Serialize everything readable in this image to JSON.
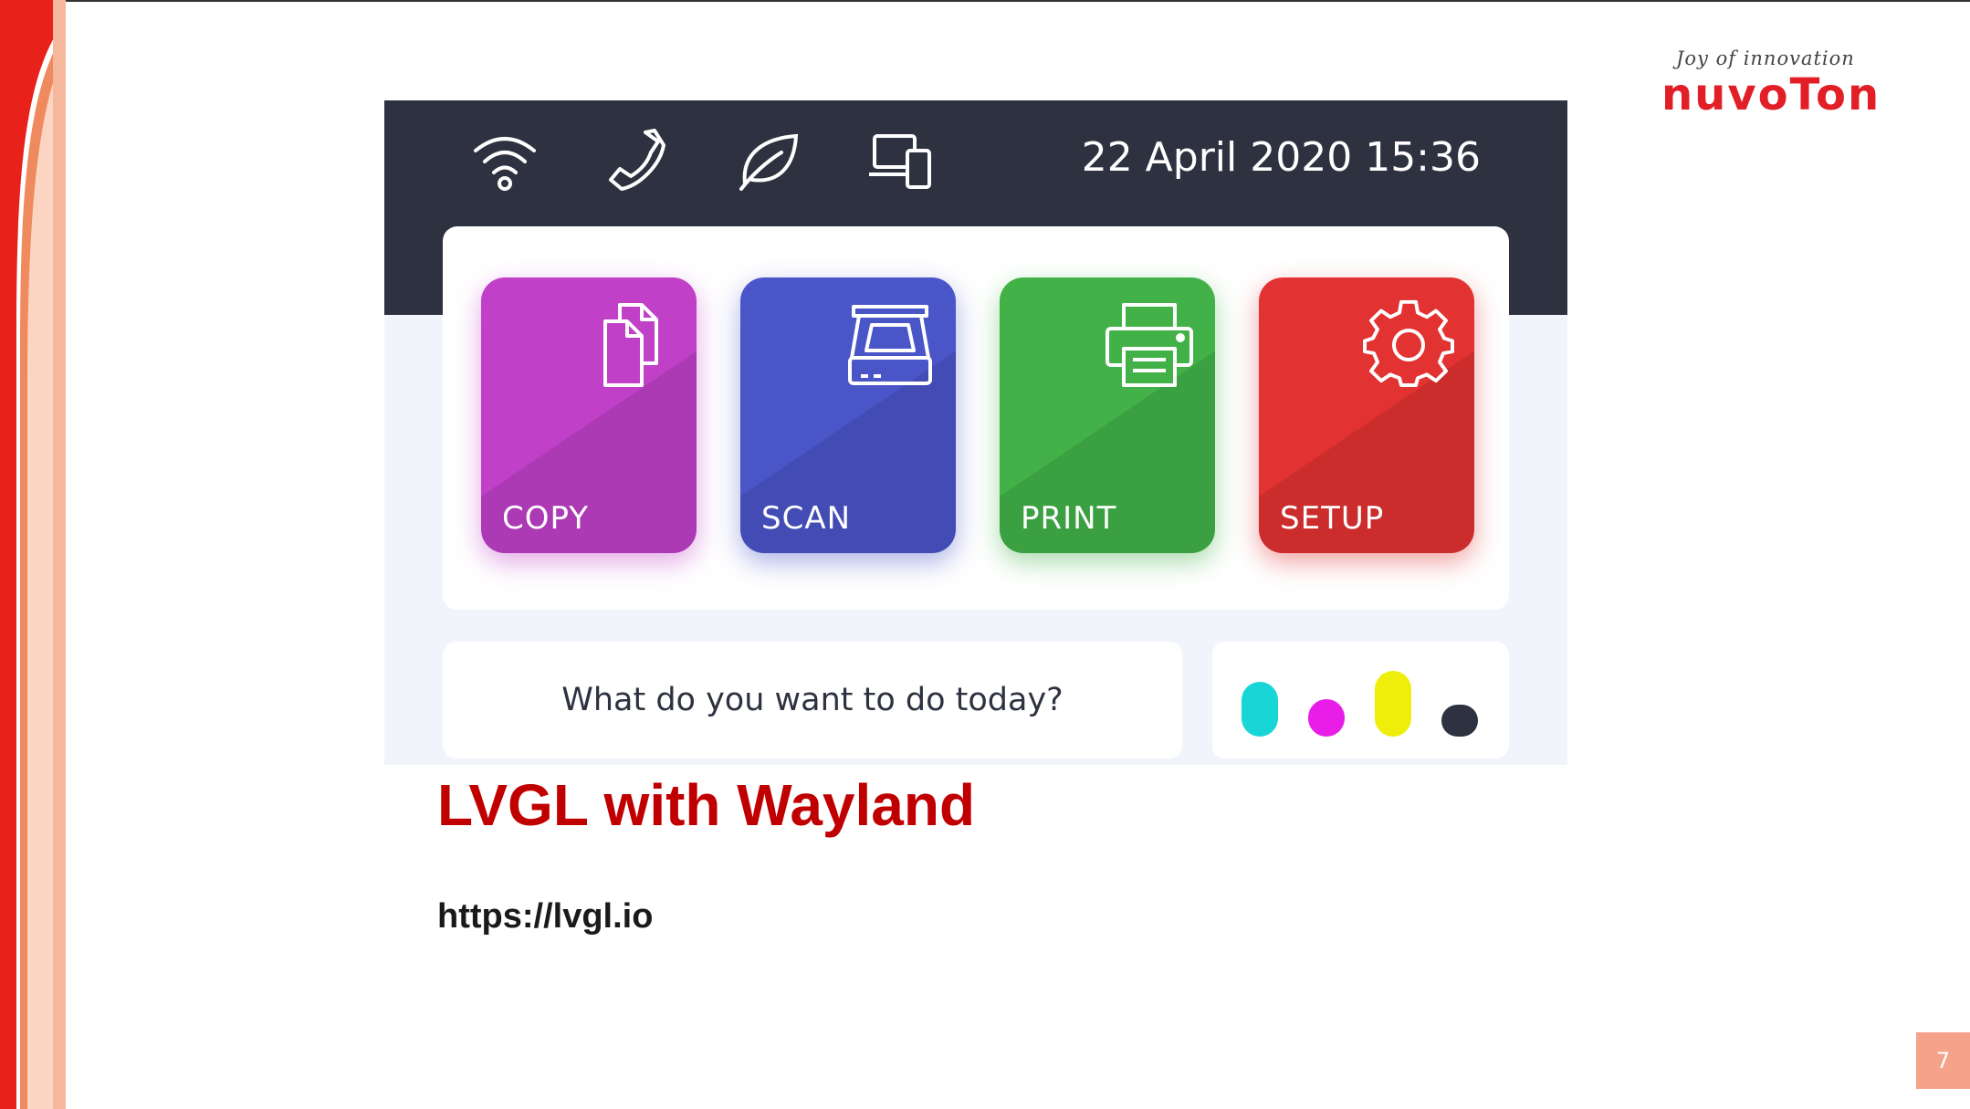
{
  "logo": {
    "tagline": "Joy of innovation",
    "wordmark": "nuvoTon",
    "color": "#e21f26"
  },
  "device": {
    "status_icons": [
      "wifi-icon",
      "phone-icon",
      "leaf-icon",
      "devices-icon"
    ],
    "datetime": "22 April 2020 15:36",
    "tiles": [
      {
        "label": "COPY",
        "icon": "copy-icon",
        "color": "#c040c8"
      },
      {
        "label": "SCAN",
        "icon": "scanner-icon",
        "color": "#4a55c8"
      },
      {
        "label": "PRINT",
        "icon": "printer-icon",
        "color": "#42b248"
      },
      {
        "label": "SETUP",
        "icon": "gear-icon",
        "color": "#e23232"
      }
    ],
    "prompt": "What do you want to do today?",
    "ink_levels": [
      {
        "name": "cyan",
        "color": "#19d6d6",
        "level": 0.6
      },
      {
        "name": "magenta",
        "color": "#e81ee8",
        "level": 0.3
      },
      {
        "name": "yellow",
        "color": "#eeee0a",
        "level": 0.8
      },
      {
        "name": "black",
        "color": "#2e3240",
        "level": 0.2
      }
    ]
  },
  "slide": {
    "title": "LVGL with Wayland",
    "link": "https://lvgl.io",
    "page_number": "7"
  }
}
